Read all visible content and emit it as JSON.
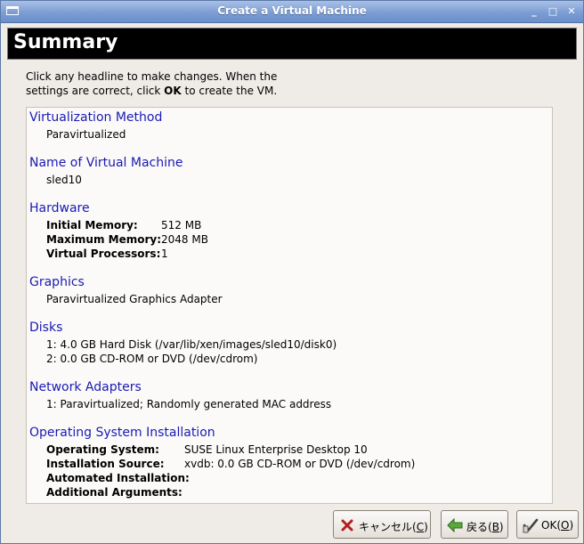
{
  "window": {
    "title": "Create a Virtual Machine",
    "menu_icon": "window-menu-icon",
    "min_glyph": "_",
    "max_glyph": "□",
    "close_glyph": "✕"
  },
  "header": {
    "title": "Summary"
  },
  "intro": {
    "line1": "Click any headline to make changes.  When the",
    "line2_pre": "settings are correct, click ",
    "line2_bold": "OK",
    "line2_post": " to create the VM."
  },
  "sections": {
    "virt": {
      "heading": "Virtualization Method",
      "value": "Paravirtualized"
    },
    "name": {
      "heading": "Name of Virtual Machine",
      "value": "sled10"
    },
    "hardware": {
      "heading": "Hardware",
      "initial_label": "Initial Memory:",
      "initial_value": "512 MB",
      "max_label": "Maximum Memory:",
      "max_value": "2048 MB",
      "cpu_label": "Virtual Processors:",
      "cpu_value": "1"
    },
    "graphics": {
      "heading": "Graphics",
      "value": "Paravirtualized Graphics Adapter"
    },
    "disks": {
      "heading": "Disks",
      "d1": "1: 4.0 GB Hard Disk (/var/lib/xen/images/sled10/disk0)",
      "d2": "2: 0.0 GB CD-ROM or DVD (/dev/cdrom)"
    },
    "network": {
      "heading": "Network Adapters",
      "n1": "1: Paravirtualized; Randomly generated MAC address"
    },
    "os": {
      "heading": "Operating System Installation",
      "os_label": "Operating System:",
      "os_value": "SUSE Linux Enterprise Desktop 10",
      "src_label": "Installation Source:",
      "src_value": "xvdb: 0.0 GB CD-ROM or DVD (/dev/cdrom)",
      "auto_label": "Automated Installation:",
      "auto_value": "",
      "args_label": "Additional Arguments:",
      "args_value": ""
    }
  },
  "buttons": {
    "cancel": {
      "label": "キャンセル(",
      "mnemonic": "C",
      "close": ")",
      "icon": "cancel-x-icon"
    },
    "back": {
      "label": "戻る(",
      "mnemonic": "B",
      "close": ")",
      "icon": "back-arrow-icon"
    },
    "ok": {
      "label": "OK(",
      "mnemonic": "O",
      "close": ")",
      "icon": "ok-hand-icon"
    }
  },
  "colors": {
    "heading_link": "#1a1ab4",
    "title_bar": "#7c9dd3",
    "background": "#efebe7"
  }
}
